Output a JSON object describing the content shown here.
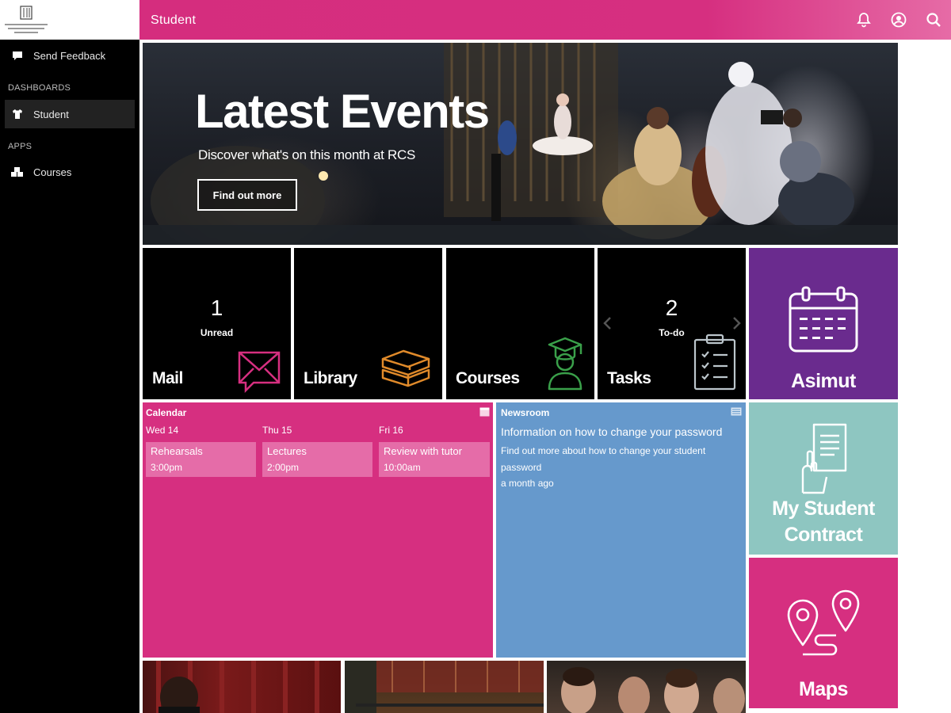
{
  "topbar": {
    "title": "Student"
  },
  "sidebar": {
    "feedback_label": "Send Feedback",
    "dashboards_heading": "DASHBOARDS",
    "student_label": "Student",
    "apps_heading": "APPS",
    "courses_label": "Courses"
  },
  "hero": {
    "title": "Latest Events",
    "subtitle": "Discover what's on this month at RCS",
    "button_label": "Find out more"
  },
  "tiles": {
    "mail": {
      "label": "Mail",
      "count": "1",
      "count_label": "Unread"
    },
    "library": {
      "label": "Library"
    },
    "courses": {
      "label": "Courses"
    },
    "tasks": {
      "label": "Tasks",
      "count": "2",
      "count_label": "To-do"
    },
    "asimut": {
      "label": "Asimut"
    },
    "contract": {
      "label_line1": "My Student",
      "label_line2": "Contract"
    },
    "maps": {
      "label": "Maps"
    }
  },
  "calendar": {
    "title": "Calendar",
    "days": [
      {
        "day": "Wed 14",
        "event": "Rehearsals",
        "time": "3:00pm"
      },
      {
        "day": "Thu 15",
        "event": "Lectures",
        "time": "2:00pm"
      },
      {
        "day": "Fri 16",
        "event": "Review with tutor",
        "time": "10:00am"
      }
    ]
  },
  "newsroom": {
    "title": "Newsroom",
    "headline": "Information on how to change your password",
    "desc": "Find out more about how to change your student password",
    "ago": "a month ago"
  },
  "colors": {
    "brand_pink": "#d62f80",
    "purple": "#6a2b8e",
    "teal": "#8ec6c1",
    "blue": "#6699cc"
  }
}
